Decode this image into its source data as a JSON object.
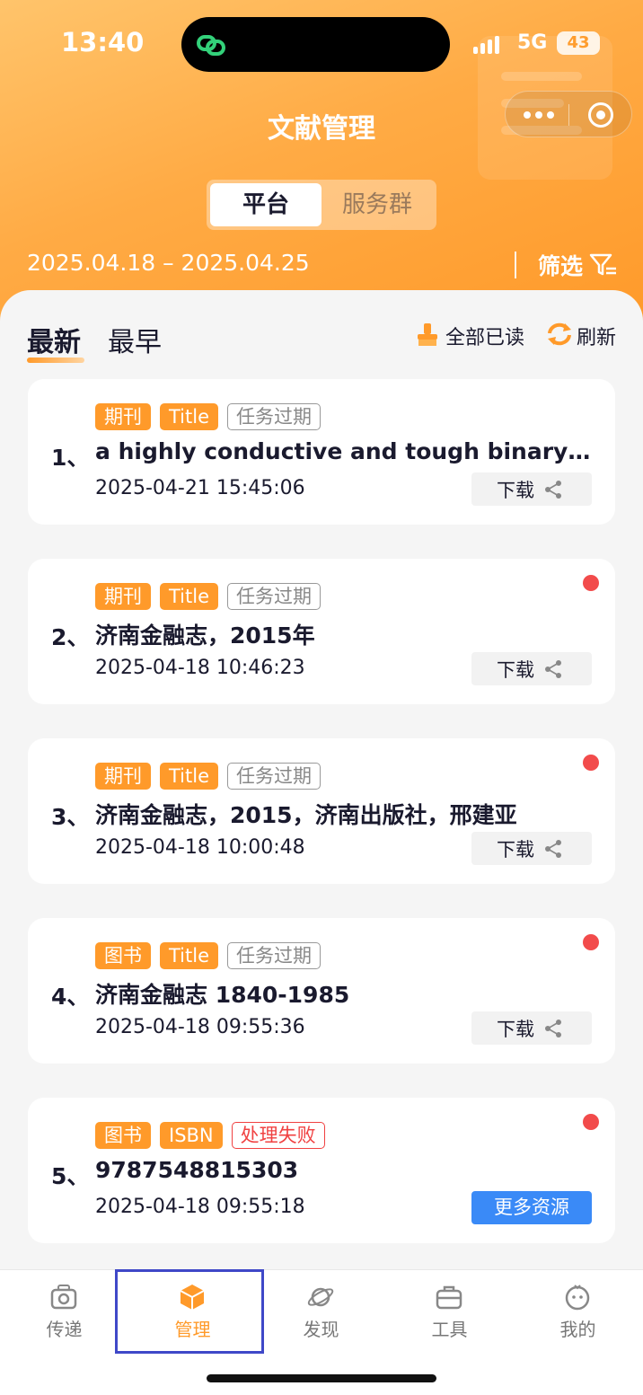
{
  "status_bar": {
    "time": "13:40",
    "network": "5G",
    "battery": "43"
  },
  "header": {
    "title": "文献管理",
    "segments": [
      "平台",
      "服务群"
    ],
    "active_segment": "平台",
    "date_range": "2025.04.18 – 2025.04.25",
    "filter_label": "筛选"
  },
  "list_header": {
    "tabs": [
      "最新",
      "最早"
    ],
    "active_tab": "最新",
    "mark_all_read": "全部已读",
    "refresh": "刷新"
  },
  "records": [
    {
      "index": "1、",
      "tags": [
        {
          "text": "期刊",
          "style": "orange"
        },
        {
          "text": "Title",
          "style": "orange"
        },
        {
          "text": "任务过期",
          "style": "gray"
        }
      ],
      "title": "a highly conductive and tough binary me...",
      "datetime": "2025-04-21 15:45:06",
      "action": "下载",
      "unread": false
    },
    {
      "index": "2、",
      "tags": [
        {
          "text": "期刊",
          "style": "orange"
        },
        {
          "text": "Title",
          "style": "orange"
        },
        {
          "text": "任务过期",
          "style": "gray"
        }
      ],
      "title": "济南金融志，2015年",
      "datetime": "2025-04-18 10:46:23",
      "action": "下载",
      "unread": true
    },
    {
      "index": "3、",
      "tags": [
        {
          "text": "期刊",
          "style": "orange"
        },
        {
          "text": "Title",
          "style": "orange"
        },
        {
          "text": "任务过期",
          "style": "gray"
        }
      ],
      "title": "济南金融志，2015，济南出版社，邢建亚",
      "datetime": "2025-04-18 10:00:48",
      "action": "下载",
      "unread": true
    },
    {
      "index": "4、",
      "tags": [
        {
          "text": "图书",
          "style": "orange"
        },
        {
          "text": "Title",
          "style": "orange"
        },
        {
          "text": "任务过期",
          "style": "gray"
        }
      ],
      "title": "济南金融志 1840-1985",
      "datetime": "2025-04-18 09:55:36",
      "action": "下载",
      "unread": true
    },
    {
      "index": "5、",
      "tags": [
        {
          "text": "图书",
          "style": "orange"
        },
        {
          "text": "ISBN",
          "style": "orange"
        },
        {
          "text": "处理失败",
          "style": "red"
        }
      ],
      "title": "9787548815303",
      "datetime": "2025-04-18 09:55:18",
      "action": "更多资源",
      "unread": true
    }
  ],
  "tabbar": {
    "items": [
      {
        "label": "传递",
        "icon": "camera-icon"
      },
      {
        "label": "管理",
        "icon": "box-icon"
      },
      {
        "label": "发现",
        "icon": "planet-icon"
      },
      {
        "label": "工具",
        "icon": "toolbox-icon"
      },
      {
        "label": "我的",
        "icon": "profile-icon"
      }
    ],
    "active": "管理"
  },
  "colors": {
    "accent": "#ff9a2a",
    "primary_button": "#3a8af7",
    "unread_dot": "#f24b4b",
    "error": "#f04141"
  }
}
